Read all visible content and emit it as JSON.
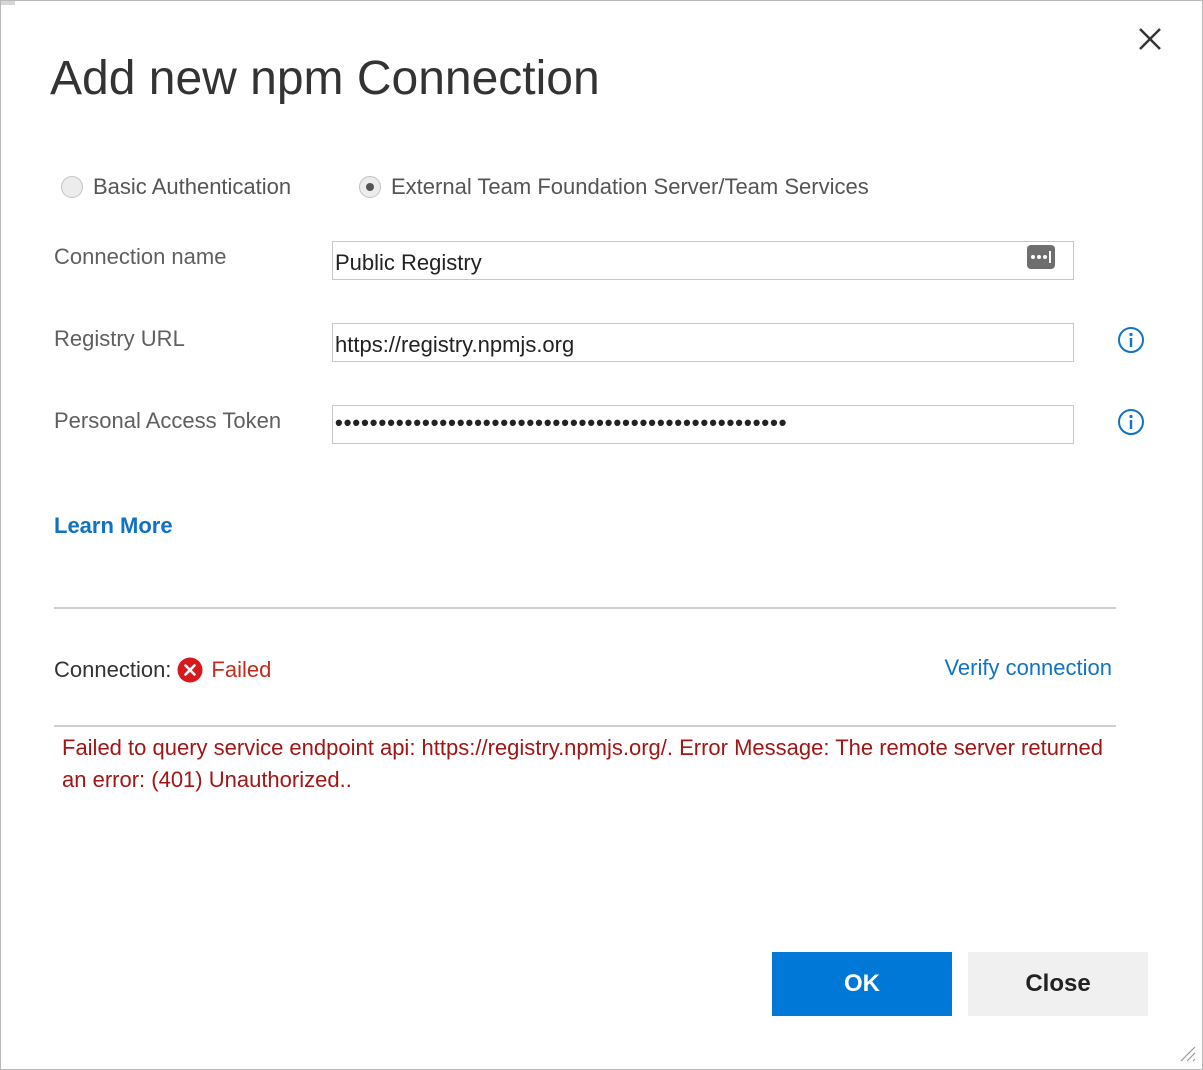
{
  "dialog": {
    "title": "Add new npm Connection",
    "close_icon": "close-icon"
  },
  "auth_options": [
    {
      "label": "Basic Authentication",
      "selected": false
    },
    {
      "label": "External Team Foundation Server/Team Services",
      "selected": true
    }
  ],
  "fields": {
    "connection_name": {
      "label": "Connection name",
      "value": "Public Registry"
    },
    "registry_url": {
      "label": "Registry URL",
      "value": "https://registry.npmjs.org"
    },
    "personal_access_token": {
      "label": "Personal Access Token",
      "value": "••••••••••••••••••••••••••••••••••••••••••••••••••••"
    }
  },
  "links": {
    "learn_more": "Learn More",
    "verify_connection": "Verify connection"
  },
  "connection_status": {
    "label": "Connection:",
    "status": "Failed",
    "status_color": "#c42b1c",
    "icon": "error-icon"
  },
  "error_message": "Failed to query service endpoint api: https://registry.npmjs.org/. Error Message: The remote server returned an error: (401) Unauthorized..",
  "buttons": {
    "ok": "OK",
    "close": "Close"
  },
  "colors": {
    "accent": "#0078d7",
    "link": "#1074c6",
    "error_text": "#a31515"
  }
}
